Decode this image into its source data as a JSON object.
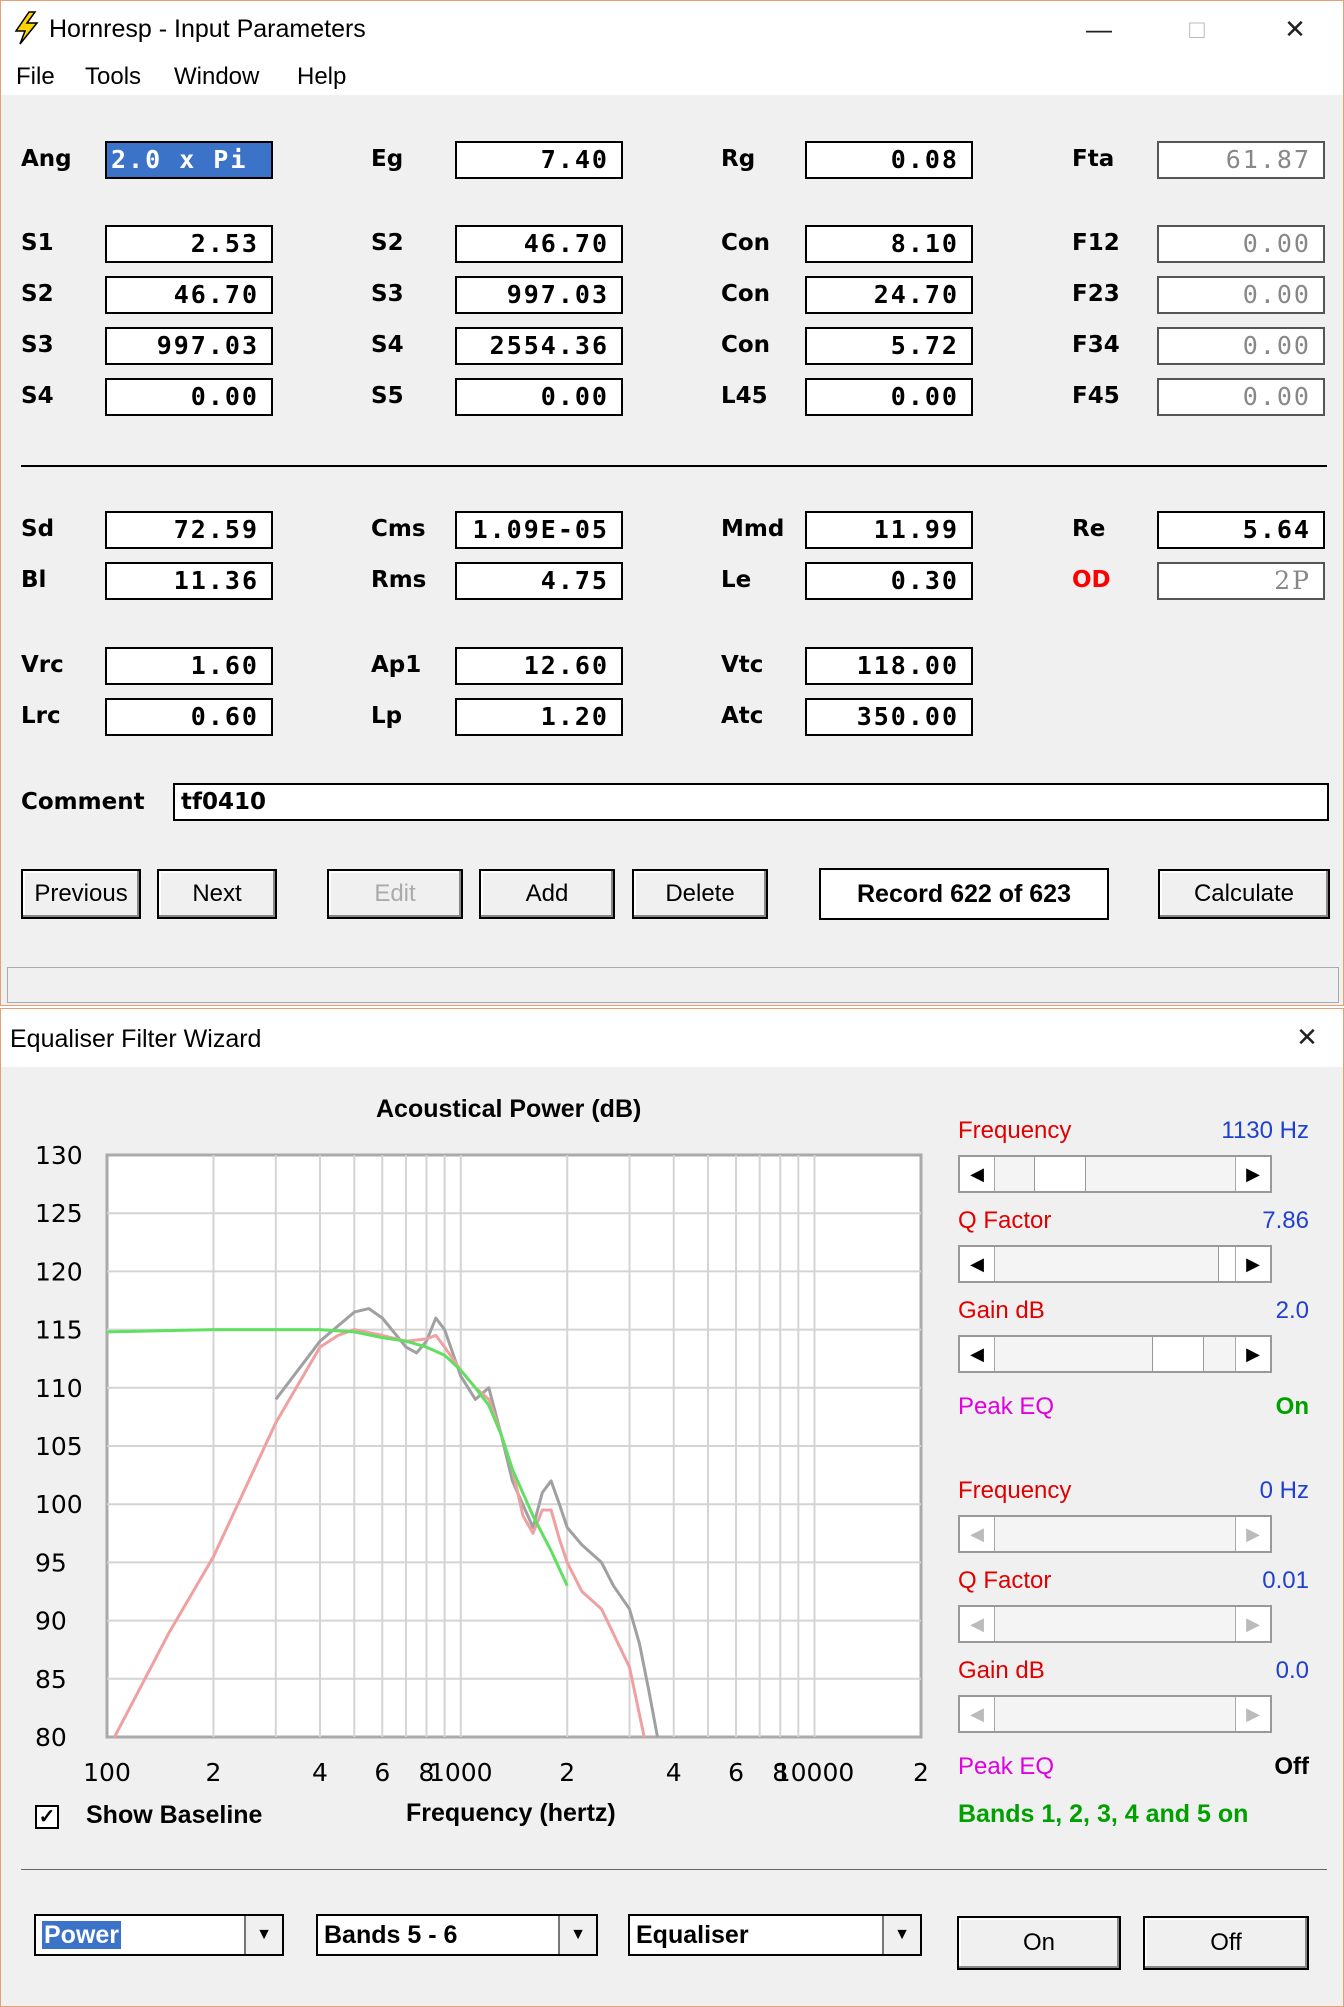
{
  "window1": {
    "title": "Hornresp - Input Parameters",
    "menu": [
      "File",
      "Tools",
      "Window",
      "Help"
    ],
    "rows": [
      [
        [
          "Ang",
          "2.0 x Pi"
        ],
        [
          "Eg",
          "7.40"
        ],
        [
          "Rg",
          "0.08"
        ],
        [
          "Fta",
          "61.87"
        ]
      ],
      [
        [
          "S1",
          "2.53"
        ],
        [
          "S2",
          "46.70"
        ],
        [
          "Con",
          "8.10"
        ],
        [
          "F12",
          "0.00"
        ]
      ],
      [
        [
          "S2",
          "46.70"
        ],
        [
          "S3",
          "997.03"
        ],
        [
          "Con",
          "24.70"
        ],
        [
          "F23",
          "0.00"
        ]
      ],
      [
        [
          "S3",
          "997.03"
        ],
        [
          "S4",
          "2554.36"
        ],
        [
          "Con",
          "5.72"
        ],
        [
          "F34",
          "0.00"
        ]
      ],
      [
        [
          "S4",
          "0.00"
        ],
        [
          "S5",
          "0.00"
        ],
        [
          "L45",
          "0.00"
        ],
        [
          "F45",
          "0.00"
        ]
      ],
      [
        [
          "Sd",
          "72.59"
        ],
        [
          "Cms",
          "1.09E-05"
        ],
        [
          "Mmd",
          "11.99"
        ],
        [
          "Re",
          "5.64"
        ]
      ],
      [
        [
          "Bl",
          "11.36"
        ],
        [
          "Rms",
          "4.75"
        ],
        [
          "Le",
          "0.30"
        ],
        [
          "OD",
          "2P"
        ]
      ],
      [
        [
          "Vrc",
          "1.60"
        ],
        [
          "Ap1",
          "12.60"
        ],
        [
          "Vtc",
          "118.00"
        ]
      ],
      [
        [
          "Lrc",
          "0.60"
        ],
        [
          "Lp",
          "1.20"
        ],
        [
          "Atc",
          "350.00"
        ]
      ]
    ],
    "comment_label": "Comment",
    "comment_value": "tf0410",
    "buttons": {
      "previous": "Previous",
      "next": "Next",
      "edit": "Edit",
      "add": "Add",
      "delete": "Delete",
      "calculate": "Calculate"
    },
    "record": "Record 622 of 623",
    "colors": {
      "od_label": "#ff0000",
      "selection": "#3a73c8"
    }
  },
  "window2": {
    "title": "Equaliser Filter Wizard",
    "show_baseline": "Show Baseline",
    "show_baseline_checked": true,
    "bands_status": "Bands 1, 2, 3, 4 and 5 on",
    "filter1": {
      "freq_label": "Frequency",
      "freq_value": "1130 Hz",
      "q_label": "Q Factor",
      "q_value": "7.86",
      "gain_label": "Gain  dB",
      "gain_value": "2.0",
      "peak_label": "Peak EQ",
      "peak_value": "On"
    },
    "filter2": {
      "freq_label": "Frequency",
      "freq_value": "0 Hz",
      "q_label": "Q Factor",
      "q_value": "0.01",
      "gain_label": "Gain  dB",
      "gain_value": "0.0",
      "peak_label": "Peak EQ",
      "peak_value": "Off"
    },
    "combos": [
      "Power",
      "Bands 5 - 6",
      "Equaliser"
    ],
    "on_button": "On",
    "off_button": "Off",
    "colors": {
      "label_red": "#e00000",
      "value_blue": "#2040d0",
      "peak_magenta": "#e000e0",
      "green": "#00a000"
    }
  },
  "chart_data": {
    "type": "line",
    "title": "Acoustical Power (dB)",
    "xlabel": "Frequency (hertz)",
    "ylabel": "",
    "x_scale": "log",
    "xlim": [
      100,
      20000
    ],
    "ylim": [
      80,
      130
    ],
    "yticks": [
      130,
      125,
      120,
      115,
      110,
      105,
      100,
      95,
      90,
      85,
      80
    ],
    "xtick_labels": [
      {
        "v": 100,
        "t": "100"
      },
      {
        "v": 200,
        "t": "2"
      },
      {
        "v": 400,
        "t": "4"
      },
      {
        "v": 600,
        "t": "6"
      },
      {
        "v": 800,
        "t": "8"
      },
      {
        "v": 1000,
        "t": "1000"
      },
      {
        "v": 2000,
        "t": "2"
      },
      {
        "v": 4000,
        "t": "4"
      },
      {
        "v": 6000,
        "t": "6"
      },
      {
        "v": 8000,
        "t": "8"
      },
      {
        "v": 10000,
        "t": "10000"
      },
      {
        "v": 20000,
        "t": "2"
      }
    ],
    "series": [
      {
        "color": "#a0a0a0",
        "points": [
          [
            300,
            109
          ],
          [
            400,
            114
          ],
          [
            500,
            116.5
          ],
          [
            550,
            116.8
          ],
          [
            600,
            116
          ],
          [
            700,
            113.5
          ],
          [
            750,
            113
          ],
          [
            800,
            114
          ],
          [
            850,
            116
          ],
          [
            900,
            115
          ],
          [
            1000,
            111
          ],
          [
            1100,
            109
          ],
          [
            1200,
            110
          ],
          [
            1300,
            106
          ],
          [
            1400,
            102
          ],
          [
            1600,
            98
          ],
          [
            1700,
            101
          ],
          [
            1800,
            102
          ],
          [
            1900,
            100
          ],
          [
            2000,
            98
          ],
          [
            2200,
            96.5
          ],
          [
            2500,
            95
          ],
          [
            2700,
            93
          ],
          [
            3000,
            91
          ],
          [
            3200,
            88
          ],
          [
            3400,
            84
          ],
          [
            3600,
            80
          ]
        ]
      },
      {
        "color": "#f0a0a0",
        "points": [
          [
            105,
            80
          ],
          [
            150,
            89
          ],
          [
            200,
            95.5
          ],
          [
            300,
            107
          ],
          [
            400,
            113.5
          ],
          [
            450,
            114.5
          ],
          [
            500,
            115
          ],
          [
            600,
            114.5
          ],
          [
            700,
            114
          ],
          [
            800,
            114.2
          ],
          [
            850,
            114.5
          ],
          [
            900,
            113.5
          ],
          [
            1000,
            111.5
          ],
          [
            1100,
            110
          ],
          [
            1200,
            109
          ],
          [
            1300,
            106
          ],
          [
            1400,
            103
          ],
          [
            1500,
            99
          ],
          [
            1600,
            97.5
          ],
          [
            1700,
            99.5
          ],
          [
            1800,
            99.5
          ],
          [
            1900,
            97
          ],
          [
            2000,
            95
          ],
          [
            2200,
            92.5
          ],
          [
            2500,
            91
          ],
          [
            3000,
            86
          ],
          [
            3300,
            80
          ]
        ]
      },
      {
        "color": "#60e060",
        "points": [
          [
            100,
            114.8
          ],
          [
            200,
            115
          ],
          [
            300,
            115
          ],
          [
            400,
            115
          ],
          [
            500,
            114.8
          ],
          [
            600,
            114.3
          ],
          [
            700,
            114
          ],
          [
            800,
            113.5
          ],
          [
            900,
            112.8
          ],
          [
            1000,
            111.5
          ],
          [
            1100,
            110
          ],
          [
            1200,
            108.5
          ],
          [
            1300,
            106
          ],
          [
            1400,
            103
          ],
          [
            1600,
            99
          ],
          [
            1800,
            96
          ],
          [
            2000,
            93
          ]
        ]
      }
    ]
  }
}
